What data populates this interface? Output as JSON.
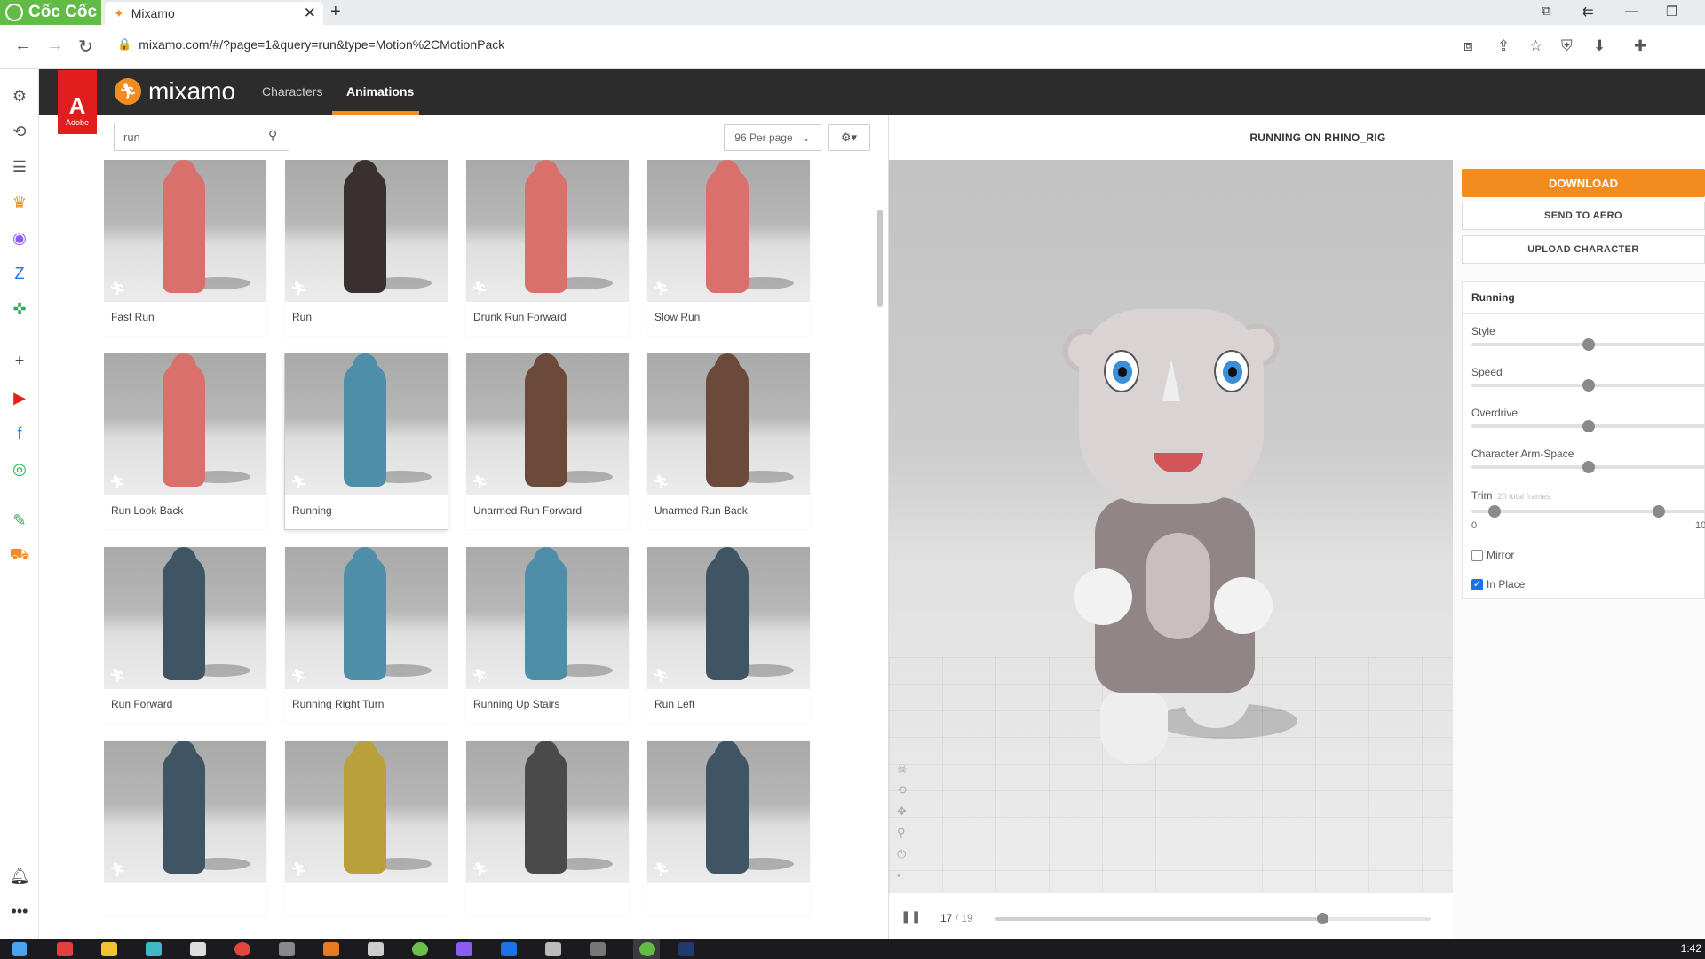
{
  "browser": {
    "brand": "Cốc Cốc",
    "tab_title": "Mixamo",
    "url": "mixamo.com/#/?page=1&query=run&type=Motion%2CMotionPack"
  },
  "header": {
    "adobe_label": "Adobe",
    "logo_text": "mixamo",
    "nav": [
      "Characters",
      "Animations"
    ],
    "active_nav": "Animations"
  },
  "toolbar": {
    "search_value": "run",
    "per_page": "96 Per page"
  },
  "animations": [
    {
      "label": "Fast Run",
      "color": "#d9706c"
    },
    {
      "label": "Run",
      "color": "#3b3030"
    },
    {
      "label": "Drunk Run Forward",
      "color": "#d9706c"
    },
    {
      "label": "Slow Run",
      "color": "#d9706c"
    },
    {
      "label": "Run Look Back",
      "color": "#d9706c"
    },
    {
      "label": "Running",
      "color": "#4f8ea8",
      "selected": true
    },
    {
      "label": "Unarmed Run Forward",
      "color": "#6b4a3a"
    },
    {
      "label": "Unarmed Run Back",
      "color": "#6b4a3a"
    },
    {
      "label": "Run Forward",
      "color": "#3f5563"
    },
    {
      "label": "Running Right Turn",
      "color": "#4f8ea8"
    },
    {
      "label": "Running Up Stairs",
      "color": "#4f8ea8"
    },
    {
      "label": "Run Left",
      "color": "#3f5563"
    },
    {
      "label": "",
      "color": "#3f5563"
    },
    {
      "label": "",
      "color": "#b8a03a"
    },
    {
      "label": "",
      "color": "#4a4a4a"
    },
    {
      "label": "",
      "color": "#3f5563"
    }
  ],
  "viewer": {
    "title": "RUNNING ON RHINO_RIG",
    "frame_current": "17",
    "frame_total": "/ 19",
    "progress": 0.75
  },
  "panel": {
    "download": "DOWNLOAD",
    "send_to_aero": "SEND TO AERO",
    "upload_character": "UPLOAD CHARACTER",
    "params_title": "Running",
    "params": [
      {
        "label": "Style",
        "value": 0.5
      },
      {
        "label": "Speed",
        "value": 0.5
      },
      {
        "label": "Overdrive",
        "value": 0.5
      },
      {
        "label": "Character Arm-Space",
        "value": 0.5
      }
    ],
    "trim_label": "Trim",
    "trim_sub": "20 total frames",
    "trim_min": "0",
    "trim_max": "10",
    "trim_start": 0.1,
    "trim_end": 0.8,
    "mirror_label": "Mirror",
    "mirror_checked": false,
    "inplace_label": "In Place",
    "inplace_checked": true
  },
  "taskbar": {
    "clock": "1:42"
  }
}
